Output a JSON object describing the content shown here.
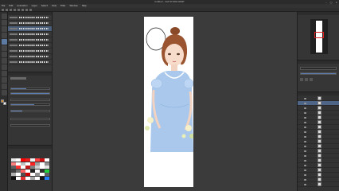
{
  "window": {
    "title": "Untitled - CLIP STUDIO PAINT",
    "controls": [
      "–",
      "□",
      "×"
    ]
  },
  "menu": [
    "File",
    "Edit",
    "Animation",
    "Layer",
    "Select",
    "View",
    "Filter",
    "Window",
    "Help"
  ],
  "palette_colors": [
    "#e8e8e8",
    "#ffffff",
    "#ff0000",
    "#e82020",
    "#f0f0f0",
    "#ff4040",
    "#d01010",
    "#ffffff",
    "#ff8080",
    "#ffffff",
    "#c0c0c0",
    "#ffffff",
    "#ff2020",
    "#a0a0a0",
    "#ffffff",
    "#909090",
    "#606060",
    "#ff3030",
    "#ffffff",
    "#c01818",
    "#808080",
    "#d0d0d0",
    "#ffffff",
    "#e0e0e0",
    "#404040",
    "#707070",
    "#ff6060",
    "#ffffff",
    "#202020",
    "#ffffff",
    "#303030",
    "#20d040",
    "#b0b0b0",
    "#ffffff",
    "#505050",
    "#cc0000",
    "#ffffff",
    "#909090",
    "#ffffff",
    "#606060",
    "#101010",
    "#ffffff",
    "#e03030",
    "#ffffff",
    "#a8a8a8",
    "#ffffff",
    "#181818",
    "#2080ff"
  ],
  "accent_color": "#5b7db1",
  "navigator_frame_color": "#e02020"
}
